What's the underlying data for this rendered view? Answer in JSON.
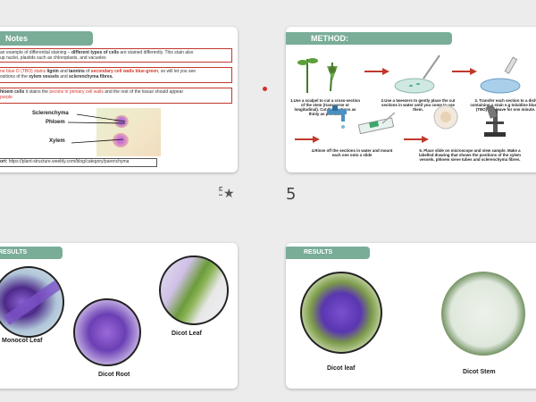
{
  "slides": {
    "notes": {
      "title": "Notes",
      "p1": "an example of differential staining –",
      "p1_bold": " different types of cells",
      "p1_rest": " are stained differently. This stain also",
      "p1b": "up nuclei, plastids such as chloroplasts, and vacuoles",
      "p2_a": "ne blue O (TBO) stains ",
      "p2_b": "lignin",
      "p2_c": " and ",
      "p2_d": "tannins",
      "p2_e": " of ",
      "p2_f": "secondary cell walls blue-green",
      "p2_g": ", so will let you see",
      "p2_h": "ositions of the ",
      "p2_i": "xylem vessels",
      "p2_j": " and ",
      "p2_k": "sclerenchyma fibres.",
      "p3_a": "hloem cells",
      "p3_b": " it stains the ",
      "p3_c": "pectins in primary cell walls",
      "p3_d": " and the rest of the tissue should appear",
      "p3_e": "purple",
      "label_scl": "Sclerenchyma",
      "label_phl": "Phloem",
      "label_xyl": "Xylem",
      "source_label": "ort:",
      "source_url": " https://plant-structure.weebly.com/blog/category/parenchyma"
    },
    "method": {
      "title": "METHOD:",
      "step1": "1.Use a scalpel to cut a cross-section of the stem (transverse or longitudinal). Cut the sections as thinly as possible",
      "step2": "2.Use a tweezers to gently place the cut sections in water until you come to use them.",
      "step3": "3. Transfer each section to a dish containing a stain e.g toluidine blue O (TBO) and leave for one minute.",
      "step4": "4.Rinse off the sections in water and mount each one onto a slide",
      "step5": "5. Place slide on microscope and view sample. Make a labelled drawing that shows the positions of the xylem vessels, phloem sieve tubes and sclerenchyma fibres."
    },
    "results1": {
      "title": "RESULTS",
      "label1": "Monocot Leaf",
      "label2": "Dicot Root",
      "label3": "Dicot Leaf"
    },
    "results2": {
      "title": "RESULTS",
      "label1": "Dicot leaf",
      "label2": "Dicot Stem"
    }
  },
  "sorter": {
    "slide_number": "5",
    "star_icon": "★",
    "partial_mark": "5"
  }
}
